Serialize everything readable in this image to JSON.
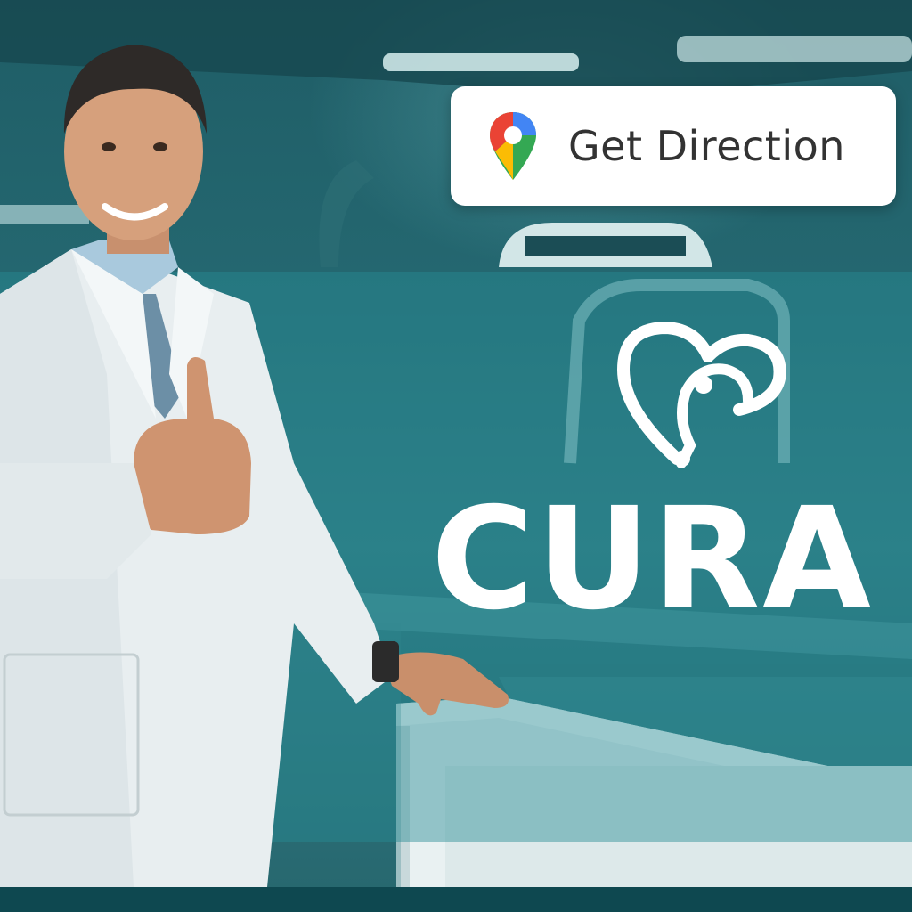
{
  "direction_button": {
    "label": "Get Direction",
    "icon": "map-pin-icon"
  },
  "brand": {
    "name": "CURA",
    "icon": "heart-stethoscope-icon"
  },
  "colors": {
    "background": "#246770",
    "accent_band": "#2a8c94",
    "bottom_bar": "#0e4850",
    "text_light": "#ffffff",
    "button_text": "#333333"
  }
}
